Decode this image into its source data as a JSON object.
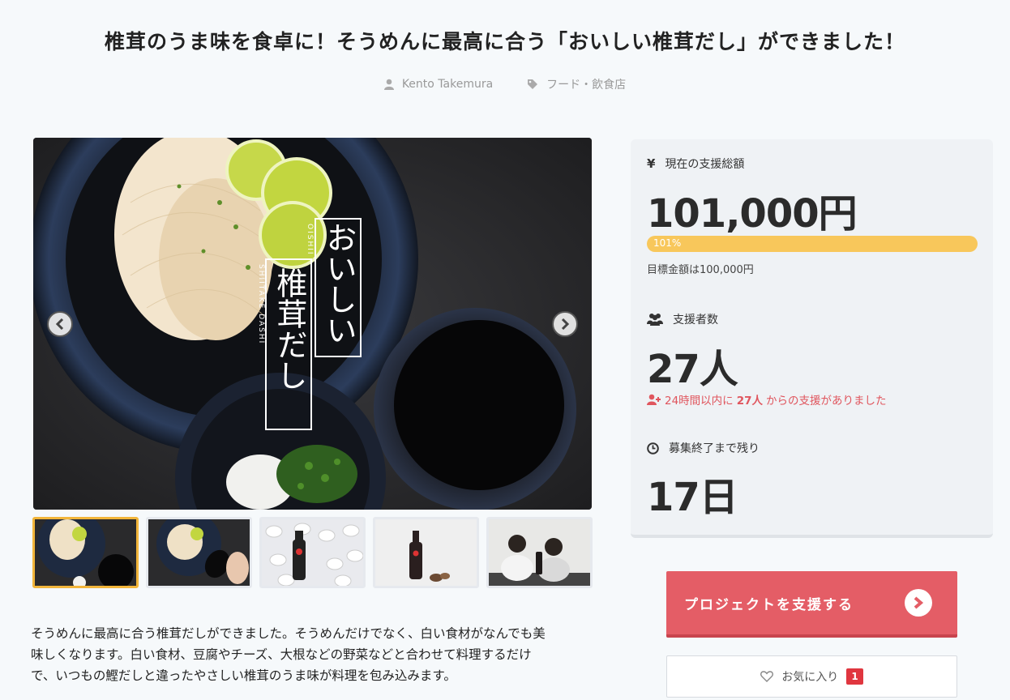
{
  "project": {
    "title": "椎茸のうま味を食卓に！そうめんに最高に合う「おいしい椎茸だし」ができました！",
    "author": "Kento Takemura",
    "category": "フード・飲食店",
    "description": [
      "そうめんに最高に合う椎茸だしができました。そうめんだけでなく、白い食材がなんでも美",
      "味しくなります。白い食材、豆腐やチーズ、大根などの野菜などと合わせて料理するだけ",
      "で、いつもの鰹だしと違ったやさしい椎茸のうま味が料理を包み込みます。"
    ]
  },
  "image": {
    "title_vertical_1": "おいしい",
    "title_vertical_2": "椎茸だし",
    "romaji_1": "OISHII",
    "romaji_2": "SHIITAKE DASHI",
    "thumbnail_count": 5,
    "active_thumbnail": 0
  },
  "stats": {
    "total_label": "現在の支援総額",
    "total_value": "101,000円",
    "progress_label": "101%",
    "progress_fraction": 1.01,
    "goal_text": "目標金額は100,000円",
    "supporters_label": "支援者数",
    "supporters_value": "27人",
    "recent_prefix": "24時間以内に",
    "recent_count": "27人",
    "recent_suffix": "からの支援がありました",
    "remaining_label": "募集終了まで残り",
    "remaining_value": "17日"
  },
  "actions": {
    "support_label": "プロジェクトを支援する",
    "favorite_label": "お気に入り",
    "favorite_count": "1"
  },
  "colors": {
    "accent_red": "#e45d66",
    "progress_yellow": "#f8c75b",
    "active_thumb_border": "#f2b53a"
  }
}
